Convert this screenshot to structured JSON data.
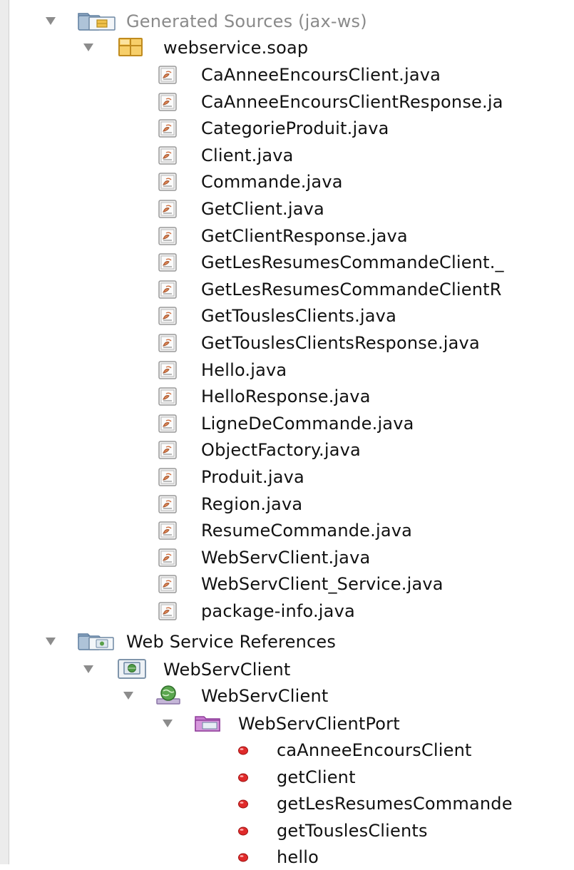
{
  "tree": {
    "generated_sources": {
      "label": "Generated Sources (jax-ws)",
      "package": {
        "label": "webservice.soap",
        "files": [
          "CaAnneeEncoursClient.java",
          "CaAnneeEncoursClientResponse.ja",
          "CategorieProduit.java",
          "Client.java",
          "Commande.java",
          "GetClient.java",
          "GetClientResponse.java",
          "GetLesResumesCommandeClient._",
          "GetLesResumesCommandeClientR",
          "GetTouslesClients.java",
          "GetTouslesClientsResponse.java",
          "Hello.java",
          "HelloResponse.java",
          "LigneDeCommande.java",
          "ObjectFactory.java",
          "Produit.java",
          "Region.java",
          "ResumeCommande.java",
          "WebServClient.java",
          "WebServClient_Service.java",
          "package-info.java"
        ]
      }
    },
    "web_service_references": {
      "label": "Web Service References",
      "client": {
        "label": "WebServClient",
        "service": {
          "label": "WebServClient",
          "port": {
            "label": "WebServClientPort",
            "operations": [
              "caAnneeEncoursClient",
              "getClient",
              "getLesResumesCommande",
              "getTouslesClients",
              "hello"
            ]
          }
        }
      }
    }
  },
  "icons": {
    "folder": "folder-icon",
    "package": "package-icon",
    "java_file": "java-file-icon",
    "web_service_folder": "web-service-folder-icon",
    "web_service": "web-service-icon",
    "globe_service": "globe-service-icon",
    "port": "port-icon",
    "operation": "operation-dot-icon"
  },
  "colors": {
    "dimmed_text": "#8a8a8a",
    "operation_dot": "#e02a2a",
    "port_folder": "#b44fc0"
  }
}
